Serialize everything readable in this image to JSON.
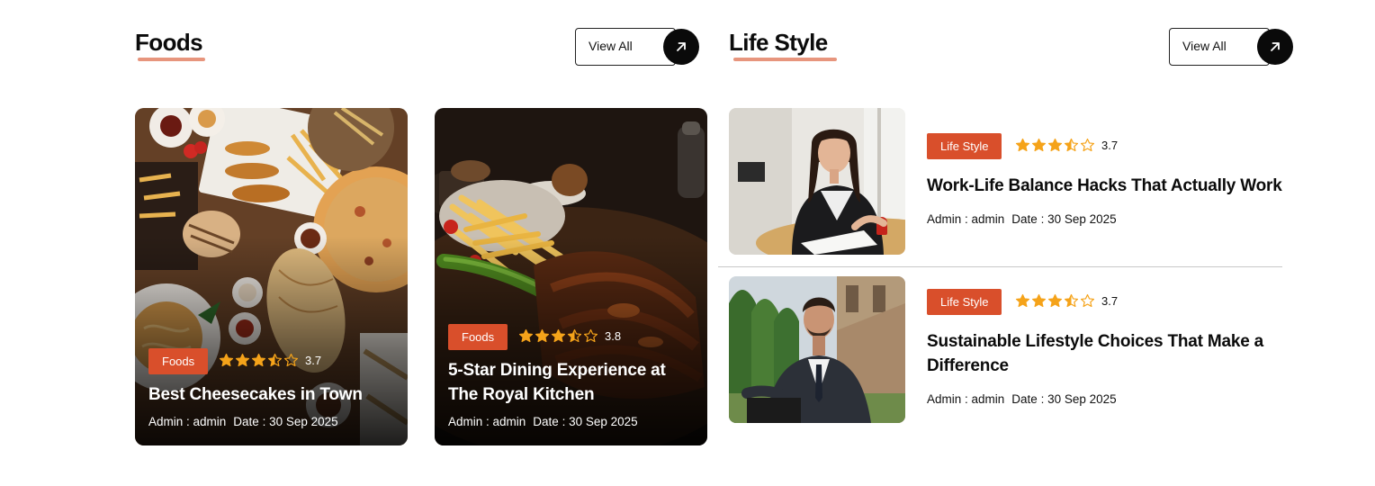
{
  "foods_section": {
    "title": "Foods",
    "view_all_label": "View All",
    "cards": [
      {
        "tag": "Foods",
        "rating": "3.7",
        "stars": 3.5,
        "title": "Best Cheesecakes in Town",
        "author": "Admin : admin",
        "date": "Date : 30 Sep 2025"
      },
      {
        "tag": "Foods",
        "rating": "3.8",
        "stars": 3.5,
        "title": "5-Star Dining Experience at The Royal Kitchen",
        "author": "Admin : admin",
        "date": "Date : 30 Sep 2025"
      }
    ]
  },
  "lifestyle_section": {
    "title": "Life Style",
    "view_all_label": "View All",
    "posts": [
      {
        "tag": "Life Style",
        "rating": "3.7",
        "stars": 3.5,
        "title": "Work-Life Balance Hacks That Actually Work",
        "author": "Admin : admin",
        "date": "Date : 30 Sep 2025"
      },
      {
        "tag": "Life Style",
        "rating": "3.7",
        "stars": 3.5,
        "title": "Sustainable Lifestyle Choices That Make a Difference",
        "author": "Admin : admin",
        "date": "Date : 30 Sep 2025"
      }
    ]
  },
  "colors": {
    "accent": "#d94f2b",
    "underline": "#e7957d",
    "star": "#f5a31a",
    "dark": "#0a0a0a"
  },
  "icons": {
    "view_all": "arrow-up-right-icon",
    "rating": "star-icon"
  }
}
